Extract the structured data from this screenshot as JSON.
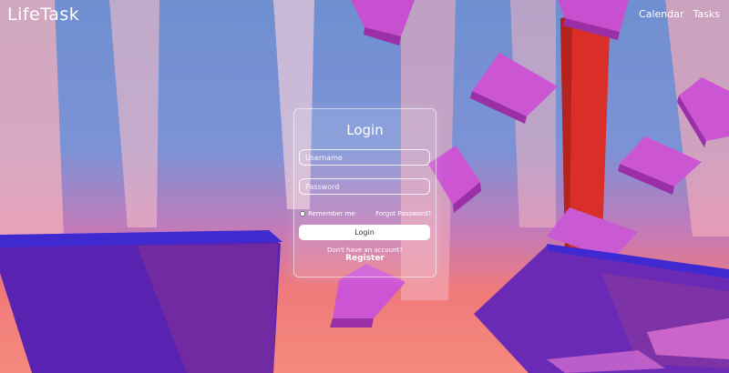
{
  "nav": {
    "logo": "LifeTask",
    "links": [
      "Calendar",
      "Tasks"
    ]
  },
  "login": {
    "title": "Login",
    "username_placeholder": "Username",
    "password_placeholder": "Password",
    "remember_label": "Remember me",
    "forgot_label": "Forgot Password?",
    "button_label": "Login",
    "no_account_text": "Don't have an account?",
    "register_label": "Register"
  },
  "colors": {
    "sky": "#6f8fd1",
    "floor": "#f58a7e",
    "cube": "#c84fd0",
    "red_column": "#d92f28",
    "slab_blue": "#5a22b0"
  }
}
